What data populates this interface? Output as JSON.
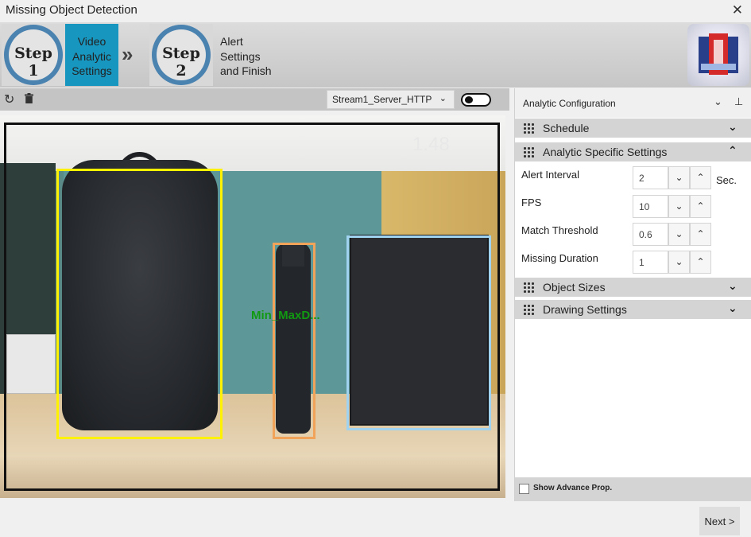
{
  "window": {
    "title": "Missing Object Detection",
    "close_glyph": "✕"
  },
  "wizard": {
    "step1_badge": "Step 1",
    "step1_label": [
      "Video",
      "Analytic",
      "Settings"
    ],
    "separator_glyph": "»",
    "step2_badge": "Step 2",
    "step2_label": [
      "Alert",
      "Settings",
      "and Finish"
    ]
  },
  "video_toolbar": {
    "refresh_icon": "↻",
    "delete_icon": "🗑",
    "stream": "Stream1_Server_HTTP",
    "stream_chevron": "⌄"
  },
  "video": {
    "overlay_value": "1.48",
    "object_label": "Min_MaxD..."
  },
  "panel": {
    "title": "Analytic Configuration",
    "chevron": "⌄",
    "pin": "⊥",
    "sections": [
      {
        "label": "Schedule",
        "state": "collapsed",
        "chevron": "⌄"
      },
      {
        "label": "Analytic Specific Settings",
        "state": "expanded",
        "chevron": "⌃"
      },
      {
        "label": "Object Sizes",
        "state": "collapsed",
        "chevron": "⌄"
      },
      {
        "label": "Drawing Settings",
        "state": "collapsed",
        "chevron": "⌄"
      }
    ],
    "fields": [
      {
        "label": "Alert Interval",
        "value": "2",
        "unit": "Sec."
      },
      {
        "label": "FPS",
        "value": "10"
      },
      {
        "label": "Match Threshold",
        "value": "0.6"
      },
      {
        "label": "Missing Duration",
        "value": "1"
      }
    ],
    "spin_down": "⌄",
    "spin_up": "⌃",
    "show_advance": "Show Advance Prop."
  },
  "footer": {
    "next": "Next >"
  },
  "colors": {
    "accent": "#1797c0",
    "bbox_frame": "#111111",
    "bbox_bag": "#fff200",
    "bbox_bottle": "#f2a35a",
    "bbox_laptop": "#9fd3f0",
    "label_green": "#119a11"
  }
}
